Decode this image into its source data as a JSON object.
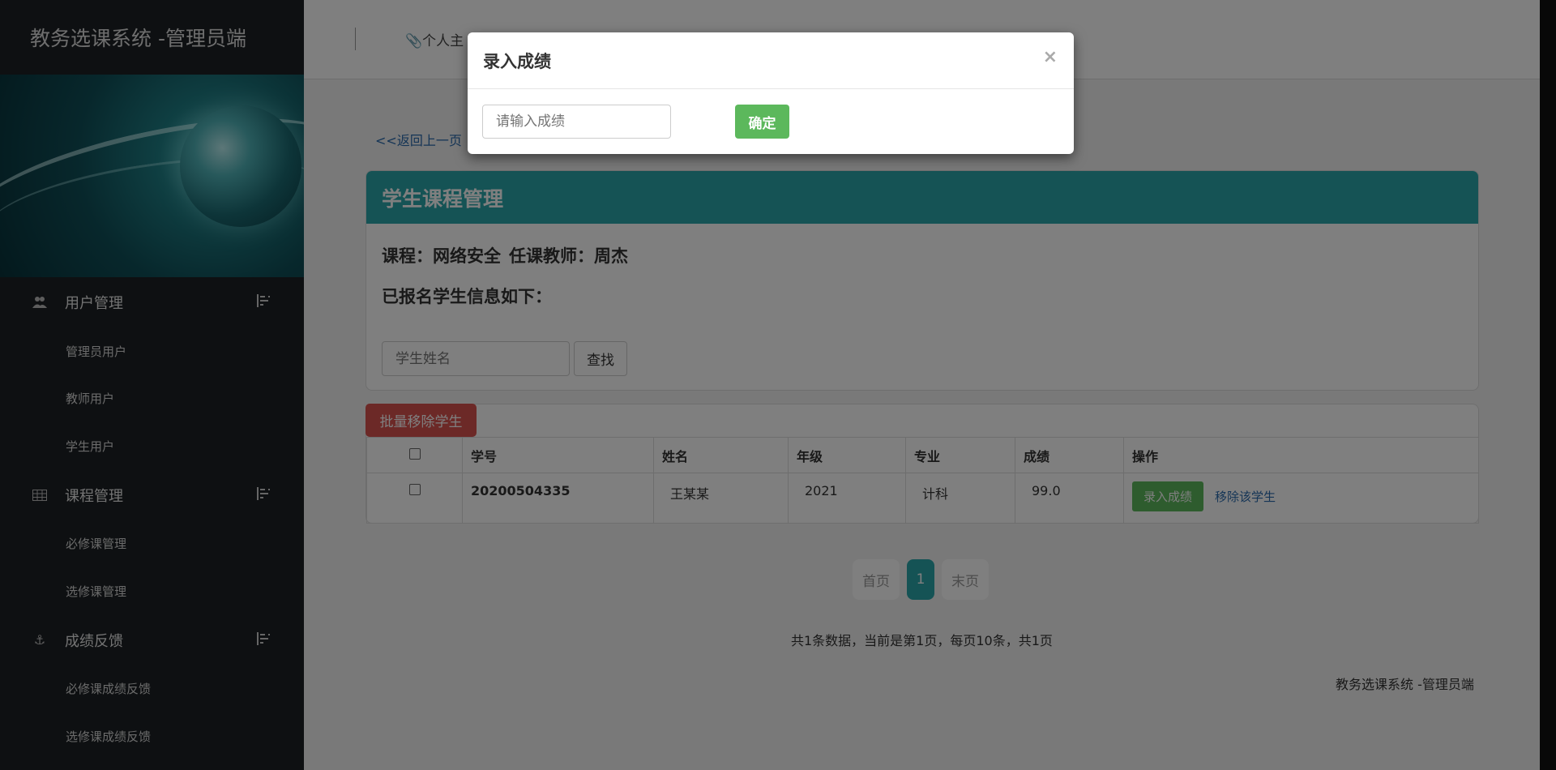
{
  "app": {
    "title": "教务选课系统 -管理员端"
  },
  "sidebar": {
    "groups": [
      {
        "label": "用户管理",
        "icon": "users-icon",
        "items": [
          "管理员用户",
          "教师用户",
          "学生用户"
        ]
      },
      {
        "label": "课程管理",
        "icon": "table-icon",
        "items": [
          "必修课管理",
          "选修课管理"
        ]
      },
      {
        "label": "成绩反馈",
        "icon": "anchor-icon",
        "items": [
          "必修课成绩反馈",
          "选修课成绩反馈"
        ]
      }
    ]
  },
  "topbar": {
    "home_label": "个人主"
  },
  "content": {
    "back_link": "<<返回上一页",
    "panel_title": "学生课程管理",
    "course_label": "课程：网络安全",
    "teacher_label": "任课教师：周杰",
    "enrolled_label": "已报名学生信息如下：",
    "search_placeholder": "学生姓名",
    "search_button": "查找",
    "batch_remove_button": "批量移除学生",
    "table": {
      "headers": [
        "学号",
        "姓名",
        "年级",
        "专业",
        "成绩",
        "操作"
      ],
      "rows": [
        {
          "student_id": "20200504335",
          "name": "王某某",
          "grade_year": "2021",
          "major": "计科",
          "score": "99.0",
          "enter_grade": "录入成绩",
          "remove": "移除该学生"
        }
      ]
    },
    "pager": {
      "first": "首页",
      "current": "1",
      "last": "末页"
    },
    "page_info": "共1条数据，当前是第1页，每页10条，共1页",
    "footer": "教务选课系统 -管理员端"
  },
  "modal": {
    "title": "录入成绩",
    "close": "×",
    "input_placeholder": "请输入成绩",
    "confirm_button": "确定"
  }
}
